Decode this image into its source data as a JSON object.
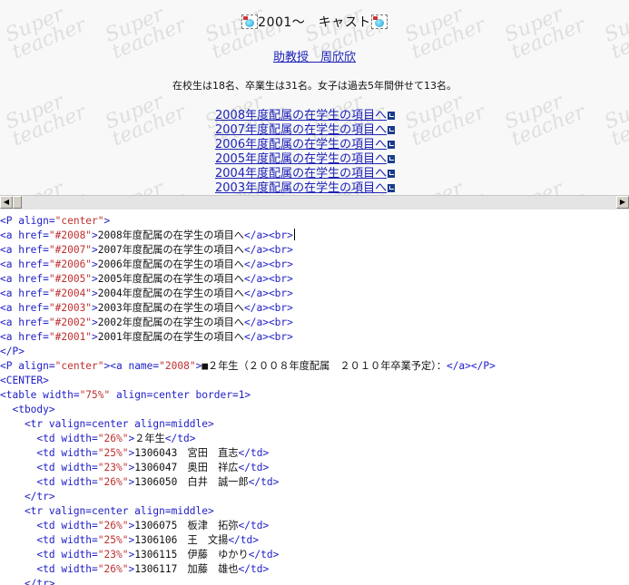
{
  "preview": {
    "watermark_text": "Super\nteacher",
    "title": "2001～　キャスト",
    "professor": "助教授　周欣欣",
    "info": "在校生は18名、卒業生は31名。女子は過去5年間併せて13名。",
    "links": [
      "2008年度配属の在学生の項目へ",
      "2007年度配属の在学生の項目へ",
      "2006年度配属の在学生の項目へ",
      "2005年度配属の在学生の項目へ",
      "2004年度配属の在学生の項目へ",
      "2003年度配属の在学生の項目へ"
    ]
  },
  "scrollbar": {
    "left_arrow": "◀",
    "right_arrow": "▶"
  },
  "source": {
    "lines": [
      [
        [
          "t",
          "<P align="
        ],
        [
          "a",
          "\"center\""
        ],
        [
          "t",
          ">"
        ]
      ],
      [
        [
          "t",
          "<a href="
        ],
        [
          "a",
          "\"#2008\""
        ],
        [
          "t",
          ">"
        ],
        [
          "x",
          "2008年度配属の在学生の項目へ"
        ],
        [
          "t",
          "</a><br>"
        ]
      ],
      [
        [
          "t",
          "<a href="
        ],
        [
          "a",
          "\"#2007\""
        ],
        [
          "t",
          ">"
        ],
        [
          "x",
          "2007年度配属の在学生の項目へ"
        ],
        [
          "t",
          "</a><br>"
        ]
      ],
      [
        [
          "t",
          "<a href="
        ],
        [
          "a",
          "\"#2006\""
        ],
        [
          "t",
          ">"
        ],
        [
          "x",
          "2006年度配属の在学生の項目へ"
        ],
        [
          "t",
          "</a><br>"
        ]
      ],
      [
        [
          "t",
          "<a href="
        ],
        [
          "a",
          "\"#2005\""
        ],
        [
          "t",
          ">"
        ],
        [
          "x",
          "2005年度配属の在学生の項目へ"
        ],
        [
          "t",
          "</a><br>"
        ]
      ],
      [
        [
          "t",
          "<a href="
        ],
        [
          "a",
          "\"#2004\""
        ],
        [
          "t",
          ">"
        ],
        [
          "x",
          "2004年度配属の在学生の項目へ"
        ],
        [
          "t",
          "</a><br>"
        ]
      ],
      [
        [
          "t",
          "<a href="
        ],
        [
          "a",
          "\"#2003\""
        ],
        [
          "t",
          ">"
        ],
        [
          "x",
          "2003年度配属の在学生の項目へ"
        ],
        [
          "t",
          "</a><br>"
        ]
      ],
      [
        [
          "t",
          "<a href="
        ],
        [
          "a",
          "\"#2002\""
        ],
        [
          "t",
          ">"
        ],
        [
          "x",
          "2002年度配属の在学生の項目へ"
        ],
        [
          "t",
          "</a><br>"
        ]
      ],
      [
        [
          "t",
          "<a href="
        ],
        [
          "a",
          "\"#2001\""
        ],
        [
          "t",
          ">"
        ],
        [
          "x",
          "2001年度配属の在学生の項目へ"
        ],
        [
          "t",
          "</a><br>"
        ]
      ],
      [
        [
          "t",
          "</P>"
        ]
      ],
      [
        [
          "t",
          "<P align="
        ],
        [
          "a",
          "\"center\""
        ],
        [
          "t",
          "><a name="
        ],
        [
          "a",
          "\"2008\""
        ],
        [
          "t",
          ">"
        ],
        [
          "x",
          "■２年生（２００８年度配属　２０１０年卒業予定）："
        ],
        [
          "t",
          "</a></P>"
        ]
      ],
      [
        [
          "t",
          "<CENTER>"
        ]
      ],
      [
        [
          "t",
          "<table width="
        ],
        [
          "a",
          "\"75%\""
        ],
        [
          "t",
          " align=center border=1>"
        ]
      ],
      [
        [
          "t",
          "  <tbody>"
        ]
      ],
      [
        [
          "t",
          "    <tr valign=center align=middle>"
        ]
      ],
      [
        [
          "t",
          "      <td width="
        ],
        [
          "a",
          "\"26%\""
        ],
        [
          "t",
          ">"
        ],
        [
          "x",
          "２年生"
        ],
        [
          "t",
          "</td>"
        ]
      ],
      [
        [
          "t",
          "      <td width="
        ],
        [
          "a",
          "\"25%\""
        ],
        [
          "t",
          ">"
        ],
        [
          "x",
          "1306043　宮田　直志"
        ],
        [
          "t",
          "</td>"
        ]
      ],
      [
        [
          "t",
          "      <td width="
        ],
        [
          "a",
          "\"23%\""
        ],
        [
          "t",
          ">"
        ],
        [
          "x",
          "1306047　奥田　祥広"
        ],
        [
          "t",
          "</td>"
        ]
      ],
      [
        [
          "t",
          "      <td width="
        ],
        [
          "a",
          "\"26%\""
        ],
        [
          "t",
          ">"
        ],
        [
          "x",
          "1306050　白井　誠一郎"
        ],
        [
          "t",
          "</td>"
        ]
      ],
      [
        [
          "t",
          "    </tr>"
        ]
      ],
      [
        [
          "t",
          "    <tr valign=center align=middle>"
        ]
      ],
      [
        [
          "t",
          "      <td width="
        ],
        [
          "a",
          "\"26%\""
        ],
        [
          "t",
          ">"
        ],
        [
          "x",
          "1306075　板津　拓弥"
        ],
        [
          "t",
          "</td>"
        ]
      ],
      [
        [
          "t",
          "      <td width="
        ],
        [
          "a",
          "\"25%\""
        ],
        [
          "t",
          ">"
        ],
        [
          "x",
          "1306106　王　文揚"
        ],
        [
          "t",
          "</td>"
        ]
      ],
      [
        [
          "t",
          "      <td width="
        ],
        [
          "a",
          "\"23%\""
        ],
        [
          "t",
          ">"
        ],
        [
          "x",
          "1306115　伊藤　ゆかり"
        ],
        [
          "t",
          "</td>"
        ]
      ],
      [
        [
          "t",
          "      <td width="
        ],
        [
          "a",
          "\"26%\""
        ],
        [
          "t",
          ">"
        ],
        [
          "x",
          "1306117　加藤　雄也"
        ],
        [
          "t",
          "</td>"
        ]
      ],
      [
        [
          "t",
          "    </tr>"
        ]
      ]
    ]
  },
  "colors": {
    "tag": "#2020c8",
    "attr_value": "#c03030",
    "link": "#1d21b8",
    "watermark": "#dde0dd"
  }
}
